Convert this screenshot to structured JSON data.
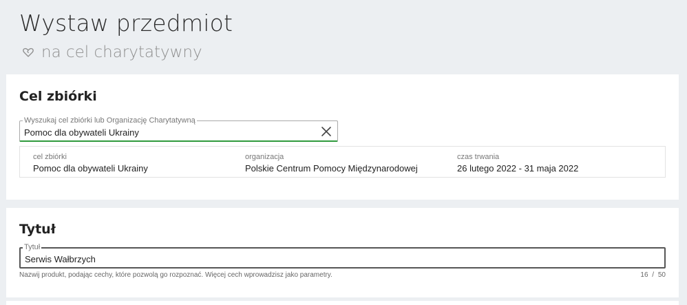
{
  "header": {
    "title": "Wystaw przedmiot",
    "subtitle": "na cel charytatywny"
  },
  "goal_section": {
    "heading": "Cel zbiórki",
    "search": {
      "label": "Wyszukaj cel zbiórki lub Organizację Charytatywną",
      "value": "Pomoc dla obywateli Ukrainy"
    },
    "summary": {
      "goal_label": "cel zbiórki",
      "goal_value": "Pomoc dla obywateli Ukrainy",
      "org_label": "organizacja",
      "org_value": "Polskie Centrum Pomocy Międzynarodowej",
      "duration_label": "czas trwania",
      "duration_value": "26 lutego 2022 - 31 maja 2022"
    }
  },
  "title_section": {
    "heading": "Tytuł",
    "field": {
      "label": "Tytuł",
      "value": "Serwis Wałbrzych"
    },
    "hint": "Nazwij produkt, podając cechy, które pozwolą go rozpoznać. Więcej cech wprowadzisz jako parametry.",
    "counter": "16 / 50"
  },
  "icons": {
    "subtitle_icon": "heart-icon",
    "clear_icon": "close-icon"
  },
  "colors": {
    "accent_green": "#2e9a3c",
    "background": "#eceff2"
  }
}
